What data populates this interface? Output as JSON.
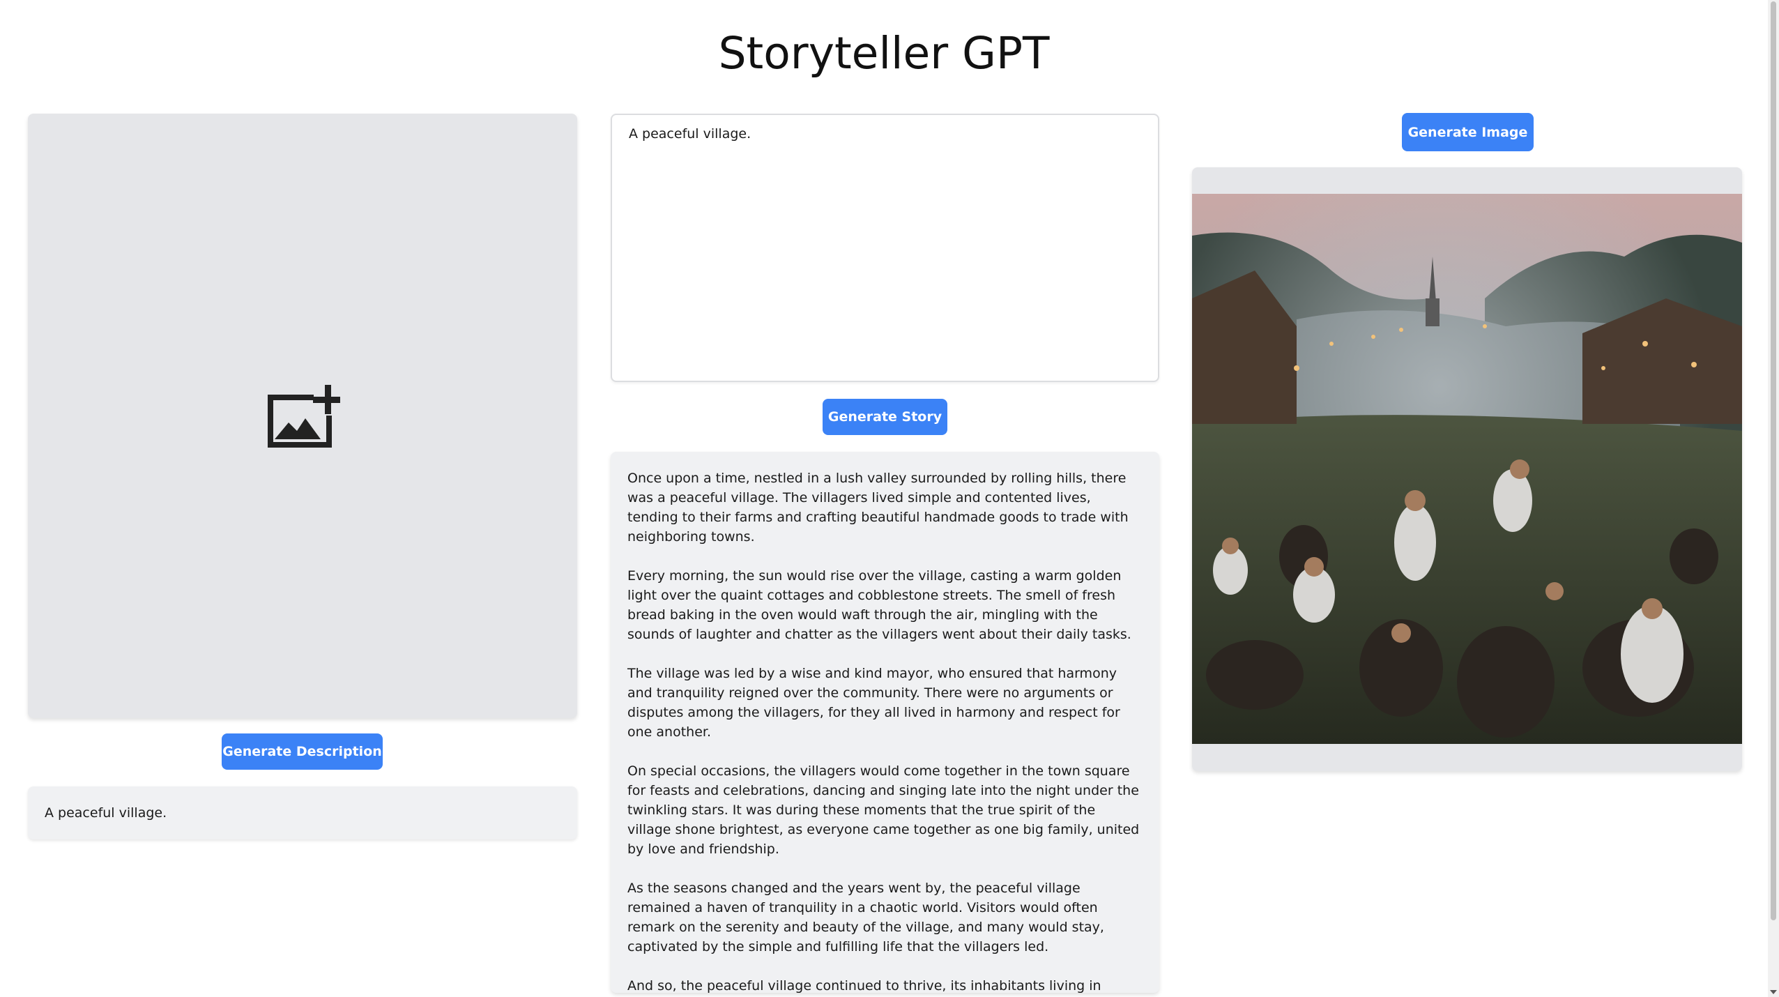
{
  "header": {
    "title": "Storyteller GPT"
  },
  "left_panel": {
    "upload_icon": "add-image-icon",
    "generate_description_label": "Generate Description",
    "description_text": "A peaceful village."
  },
  "middle_panel": {
    "prompt_value": "A peaceful village.",
    "generate_story_label": "Generate Story",
    "story_paragraphs": [
      "Once upon a time, nestled in a lush valley surrounded by rolling hills, there was a peaceful village. The villagers lived simple and contented lives, tending to their farms and crafting beautiful handmade goods to trade with neighboring towns.",
      "Every morning, the sun would rise over the village, casting a warm golden light over the quaint cottages and cobblestone streets. The smell of fresh bread baking in the oven would waft through the air, mingling with the sounds of laughter and chatter as the villagers went about their daily tasks.",
      "The village was led by a wise and kind mayor, who ensured that harmony and tranquility reigned over the community. There were no arguments or disputes among the villagers, for they all lived in harmony and respect for one another.",
      "On special occasions, the villagers would come together in the town square for feasts and celebrations, dancing and singing late into the night under the twinkling stars. It was during these moments that the true spirit of the village shone brightest, as everyone came together as one big family, united by love and friendship.",
      "As the seasons changed and the years went by, the peaceful village remained a haven of tranquility in a chaotic world. Visitors would often remark on the serenity and beauty of the village, and many would stay, captivated by the simple and fulfilling life that the villagers led.",
      "And so, the peaceful village continued to thrive, its inhabitants living in harmony and contentment, grateful for the beauty and tranquility that surrounded them each and every day."
    ]
  },
  "right_panel": {
    "generate_image_label": "Generate Image"
  },
  "colors": {
    "accent": "#3b82f6",
    "panel_bg": "#e5e6e9",
    "text_box_bg": "#f0f1f3"
  }
}
